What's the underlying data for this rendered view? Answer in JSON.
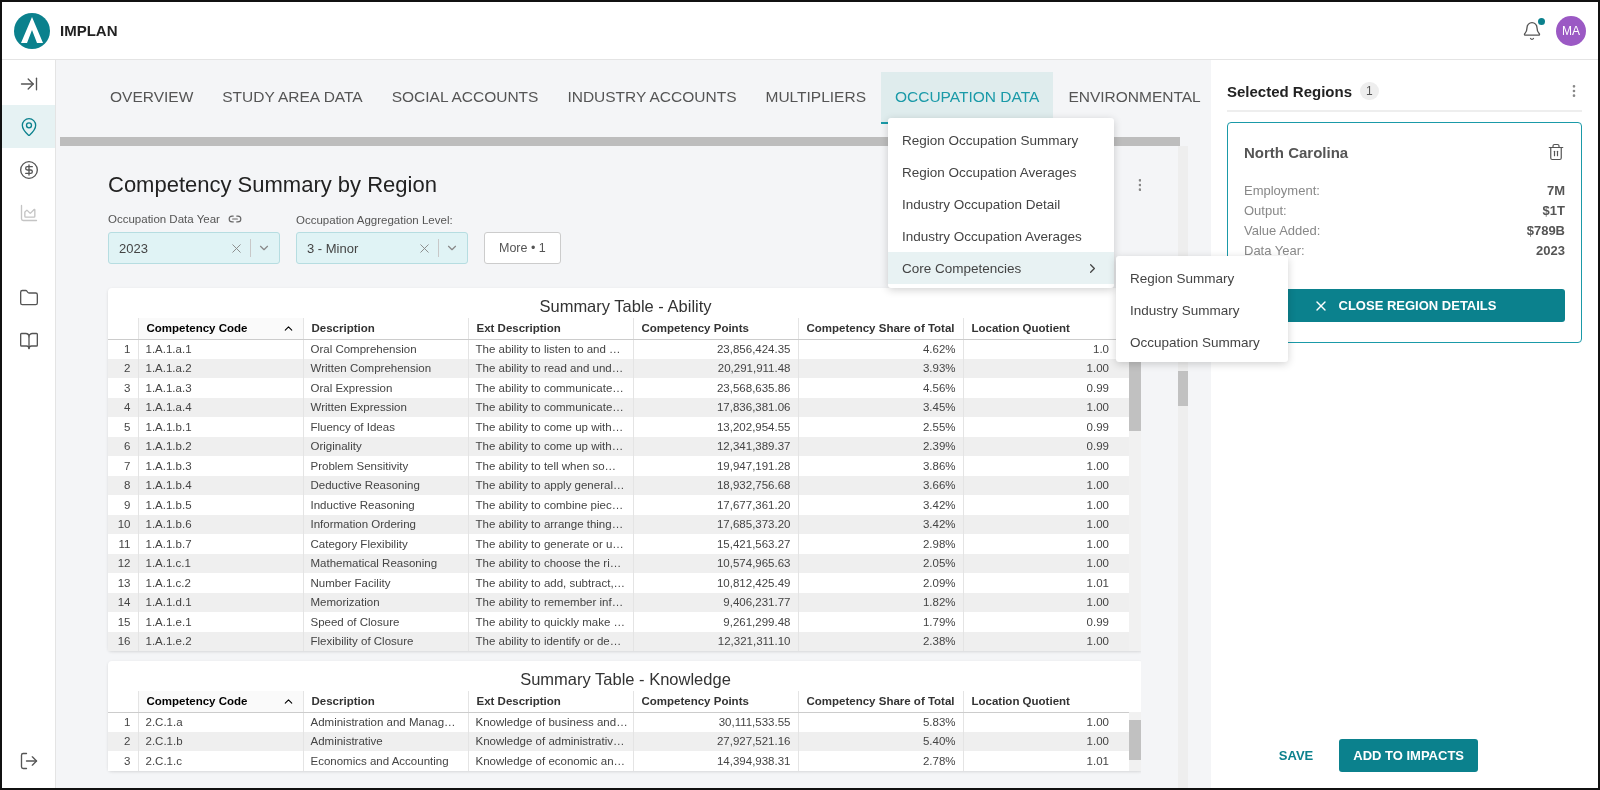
{
  "header": {
    "brand": "IMPLAN",
    "notification_dot": true,
    "avatar": "MA"
  },
  "sidebar": {
    "items": [
      {
        "kind": "expand",
        "selected": false,
        "disabled": false
      },
      {
        "kind": "pin",
        "selected": true,
        "disabled": false
      },
      {
        "kind": "dollar",
        "selected": false,
        "disabled": false
      },
      {
        "kind": "chart",
        "selected": false,
        "disabled": true
      },
      {
        "kind": "folder",
        "selected": false,
        "disabled": false
      },
      {
        "kind": "book",
        "selected": false,
        "disabled": false
      }
    ],
    "bottom": {
      "kind": "logout",
      "selected": false,
      "disabled": false
    }
  },
  "tabs": [
    {
      "label": "OVERVIEW",
      "selected": false
    },
    {
      "label": "STUDY AREA DATA",
      "selected": false
    },
    {
      "label": "SOCIAL ACCOUNTS",
      "selected": false
    },
    {
      "label": "INDUSTRY ACCOUNTS",
      "selected": false
    },
    {
      "label": "MULTIPLIERS",
      "selected": false
    },
    {
      "label": "OCCUPATION DATA",
      "selected": true
    },
    {
      "label": "ENVIRONMENTAL",
      "selected": false
    }
  ],
  "dropdown": {
    "items": [
      {
        "label": "Region Occupation Summary",
        "selected": false,
        "has_submenu": false
      },
      {
        "label": "Region Occupation Averages",
        "selected": false,
        "has_submenu": false
      },
      {
        "label": "Industry Occupation Detail",
        "selected": false,
        "has_submenu": false
      },
      {
        "label": "Industry Occupation Averages",
        "selected": false,
        "has_submenu": false
      },
      {
        "label": "Core Competencies",
        "selected": true,
        "has_submenu": true
      }
    ],
    "submenu": [
      "Region Summary",
      "Industry Summary",
      "Occupation Summary"
    ]
  },
  "page_title": "Competency Summary by Region",
  "filters": [
    {
      "label": "Occupation Data Year",
      "linked": true,
      "value": "2023"
    },
    {
      "label": "Occupation Aggregation Level:",
      "linked": false,
      "value": "3 - Minor"
    }
  ],
  "more_button": "More • 1",
  "tables": [
    {
      "title": "Summary Table - Ability",
      "columns": [
        {},
        {
          "label": "Competency Code",
          "sorted": true
        },
        {
          "label": "Description",
          "sorted": false
        },
        {
          "label": "Ext Description",
          "sorted": false
        },
        {
          "label": "Competency Points",
          "sorted": false
        },
        {
          "label": "Competency Share of Total",
          "sorted": false
        },
        {
          "label": "Location Quotient",
          "sorted": false
        }
      ],
      "rows": [
        [
          "1",
          "1.A.1.a.1",
          "Oral Comprehension",
          "The ability to listen to and …",
          "23,856,424.35",
          "4.62%",
          "1.0"
        ],
        [
          "2",
          "1.A.1.a.2",
          "Written Comprehension",
          "The ability to read and und…",
          "20,291,911.48",
          "3.93%",
          "1.00"
        ],
        [
          "3",
          "1.A.1.a.3",
          "Oral Expression",
          "The ability to communicate…",
          "23,568,635.86",
          "4.56%",
          "0.99"
        ],
        [
          "4",
          "1.A.1.a.4",
          "Written Expression",
          "The ability to communicate…",
          "17,836,381.06",
          "3.45%",
          "1.00"
        ],
        [
          "5",
          "1.A.1.b.1",
          "Fluency of Ideas",
          "The ability to come up with…",
          "13,202,954.55",
          "2.55%",
          "0.99"
        ],
        [
          "6",
          "1.A.1.b.2",
          "Originality",
          "The ability to come up with…",
          "12,341,389.37",
          "2.39%",
          "0.99"
        ],
        [
          "7",
          "1.A.1.b.3",
          "Problem Sensitivity",
          "The ability to tell when so…",
          "19,947,191.28",
          "3.86%",
          "1.00"
        ],
        [
          "8",
          "1.A.1.b.4",
          "Deductive Reasoning",
          "The ability to apply general…",
          "18,932,756.68",
          "3.66%",
          "1.00"
        ],
        [
          "9",
          "1.A.1.b.5",
          "Inductive Reasoning",
          "The ability to combine piec…",
          "17,677,361.20",
          "3.42%",
          "1.00"
        ],
        [
          "10",
          "1.A.1.b.6",
          "Information Ordering",
          "The ability to arrange thing…",
          "17,685,373.20",
          "3.42%",
          "1.00"
        ],
        [
          "11",
          "1.A.1.b.7",
          "Category Flexibility",
          "The ability to generate or u…",
          "15,421,563.27",
          "2.98%",
          "1.00"
        ],
        [
          "12",
          "1.A.1.c.1",
          "Mathematical Reasoning",
          "The ability to choose the ri…",
          "10,574,965.63",
          "2.05%",
          "1.00"
        ],
        [
          "13",
          "1.A.1.c.2",
          "Number Facility",
          "The ability to add, subtract,…",
          "10,812,425.49",
          "2.09%",
          "1.01"
        ],
        [
          "14",
          "1.A.1.d.1",
          "Memorization",
          "The ability to remember inf…",
          "9,406,231.77",
          "1.82%",
          "1.00"
        ],
        [
          "15",
          "1.A.1.e.1",
          "Speed of Closure",
          "The ability to quickly make …",
          "9,261,299.48",
          "1.79%",
          "0.99"
        ],
        [
          "16",
          "1.A.1.e.2",
          "Flexibility of Closure",
          "The ability to identify or de…",
          "12,321,311.10",
          "2.38%",
          "1.00"
        ]
      ]
    },
    {
      "title": "Summary Table - Knowledge",
      "columns": [
        {},
        {
          "label": "Competency Code",
          "sorted": true
        },
        {
          "label": "Description",
          "sorted": false
        },
        {
          "label": "Ext Description",
          "sorted": false
        },
        {
          "label": "Competency Points",
          "sorted": false
        },
        {
          "label": "Competency Share of Total",
          "sorted": false
        },
        {
          "label": "Location Quotient",
          "sorted": false
        }
      ],
      "rows": [
        [
          "1",
          "2.C.1.a",
          "Administration and Manag…",
          "Knowledge of business and…",
          "30,111,533.55",
          "5.83%",
          "1.00"
        ],
        [
          "2",
          "2.C.1.b",
          "Administrative",
          "Knowledge of administrativ…",
          "27,927,521.16",
          "5.40%",
          "1.00"
        ],
        [
          "3",
          "2.C.1.c",
          "Economics and Accounting",
          "Knowledge of economic an…",
          "14,394,938.31",
          "2.78%",
          "1.01"
        ]
      ]
    }
  ],
  "right_panel": {
    "title": "Selected Regions",
    "count": "1",
    "region": {
      "name": "North Carolina",
      "stats": [
        {
          "label": "Employment:",
          "value": "7M"
        },
        {
          "label": "Output:",
          "value": "$1T"
        },
        {
          "label": "Value Added:",
          "value": "$789B"
        },
        {
          "label": "Data Year:",
          "value": "2023"
        }
      ],
      "close_button": "CLOSE REGION DETAILS"
    },
    "save_button": "SAVE",
    "add_button": "ADD TO IMPACTS"
  }
}
